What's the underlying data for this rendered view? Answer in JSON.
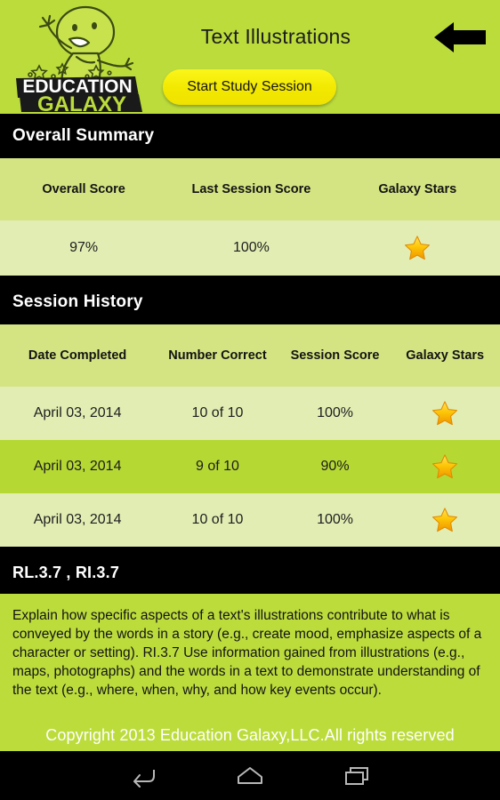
{
  "header": {
    "app_title": "Text Illustrations",
    "start_button_label": "Start Study Session",
    "back_icon": "back-arrow-icon",
    "logo_line1": "EDUCATION",
    "logo_line2": "GALAXY",
    "background_color": "#bcdc3c",
    "button_color": "#f2e800"
  },
  "overall_summary": {
    "section_title": "Overall Summary",
    "columns": [
      "Overall Score",
      "Last Session Score",
      "Galaxy Stars"
    ],
    "row": {
      "overall_score": "97%",
      "last_session_score": "100%",
      "galaxy_stars": 1,
      "star_icon": "star-icon"
    }
  },
  "session_history": {
    "section_title": "Session History",
    "columns": [
      "Date Completed",
      "Number Correct",
      "Session Score",
      "Galaxy Stars"
    ],
    "rows": [
      {
        "date": "April 03, 2014",
        "number_correct": "10 of 10",
        "session_score": "100%",
        "galaxy_stars": 1
      },
      {
        "date": "April 03, 2014",
        "number_correct": "9 of 10",
        "session_score": "90%",
        "galaxy_stars": 1
      },
      {
        "date": "April 03, 2014",
        "number_correct": "10 of 10",
        "session_score": "100%",
        "galaxy_stars": 1
      }
    ]
  },
  "standards": {
    "section_title": "RL.3.7 , RI.3.7",
    "description": "Explain how specific aspects of a text's illustrations contribute to what is conveyed by the words in a story (e.g., create mood, emphasize aspects of a character or setting). RI.3.7 Use information gained from illustrations (e.g., maps, photographs) and the words in a text to demonstrate understanding of the text (e.g., where, when, why, and how key events occur)."
  },
  "footer": {
    "copyright": "Copyright 2013 Education Galaxy,LLC.All rights reserved"
  },
  "navbar": {
    "back_label": "back-icon",
    "home_label": "home-icon",
    "recents_label": "recents-icon"
  },
  "colors": {
    "brand_green": "#bcdc3c",
    "table_header_green": "#d4e482",
    "row_light_green": "#e2edb4",
    "row_dark_green": "#b5d833",
    "star_gold": "#fcc800",
    "black_bar": "#000000"
  }
}
